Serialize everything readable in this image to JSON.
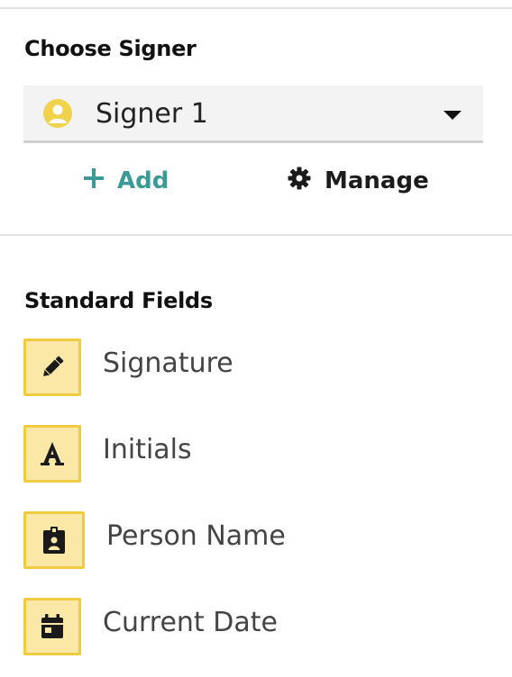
{
  "choose_signer": {
    "title": "Choose Signer",
    "selected_signer": "Signer 1",
    "add_label": "Add",
    "manage_label": "Manage"
  },
  "standard_fields": {
    "title": "Standard Fields",
    "items": [
      {
        "label": "Signature",
        "icon": "pencil-icon"
      },
      {
        "label": "Initials",
        "icon": "letter-a-icon"
      },
      {
        "label": "Person Name",
        "icon": "id-badge-icon"
      },
      {
        "label": "Current Date",
        "icon": "calendar-icon"
      }
    ]
  },
  "colors": {
    "accent_teal": "#3a9b97",
    "field_icon_bg": "#fbe8a6",
    "field_icon_border": "#f0cb3f",
    "avatar_yellow": "#f0d24d"
  }
}
